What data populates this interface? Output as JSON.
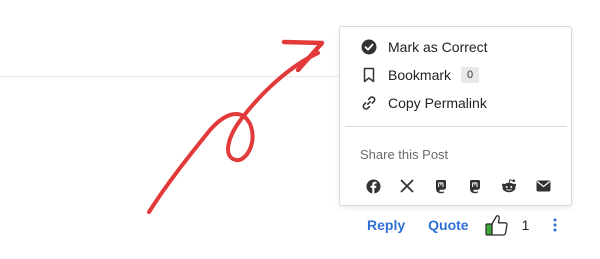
{
  "menu": {
    "mark_correct": "Mark as Correct",
    "bookmark": "Bookmark",
    "bookmark_count": "0",
    "copy_permalink": "Copy Permalink"
  },
  "share": {
    "label": "Share this Post",
    "icons": [
      "facebook-icon",
      "x-icon",
      "mastodon-icon",
      "mastodon-icon",
      "reddit-icon",
      "email-icon"
    ]
  },
  "actions": {
    "reply": "Reply",
    "quote": "Quote",
    "like_count": "1"
  },
  "colors": {
    "link": "#2f6fd6",
    "annotation": "#e23a3a",
    "like_icon_fill": "#3aaa35"
  }
}
